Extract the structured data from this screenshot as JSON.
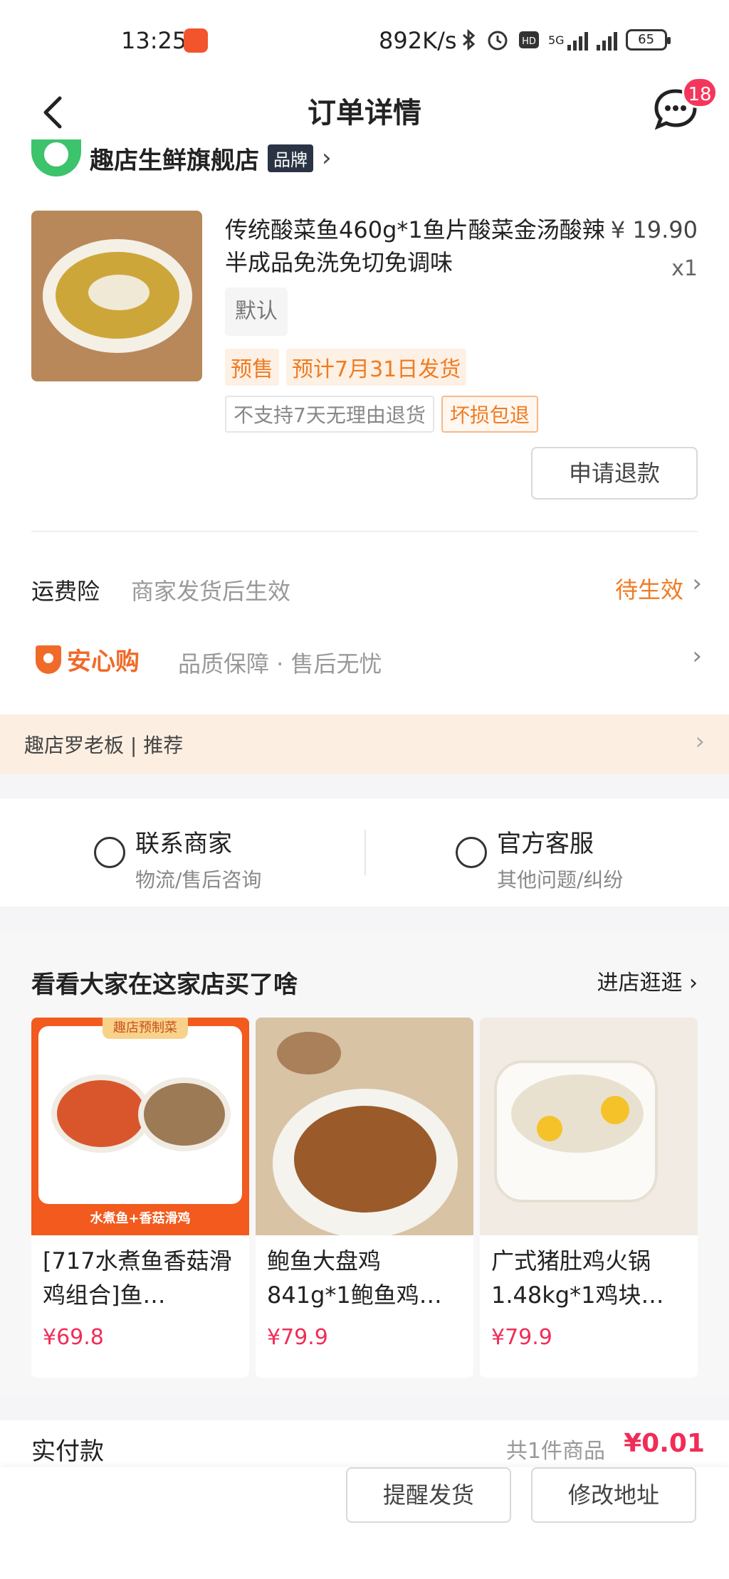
{
  "status_bar": {
    "time": "13:25",
    "net_speed": "892K/s",
    "network": "5G",
    "battery": "65"
  },
  "nav": {
    "title": "订单详情",
    "message_badge": "18"
  },
  "shop": {
    "name": "趣店生鲜旗舰店",
    "brand_tag": "品牌"
  },
  "product": {
    "title": "传统酸菜鱼460g*1鱼片酸菜金汤酸辣半成品免洗免切免调味",
    "price": "¥ 19.90",
    "quantity": "x1",
    "spec": "默认",
    "tag_presale": "预售",
    "tag_ship_date": "预计7月31日发货",
    "tag_no_return": "不支持7天无理由退货",
    "tag_damage": "坏损包退",
    "refund_button": "申请退款"
  },
  "insurance": {
    "label": "运费险",
    "desc": "商家发货后生效",
    "status": "待生效"
  },
  "anxin": {
    "label": "安心购",
    "desc": "品质保障 · 售后无忧"
  },
  "recommend_bar": {
    "text": "趣店罗老板 | 推荐"
  },
  "contact": {
    "merchant_title": "联系商家",
    "merchant_sub": "物流/售后咨询",
    "service_title": "官方客服",
    "service_sub": "其他问题/纠纷"
  },
  "recommendations": {
    "heading": "看看大家在这家店买了啥",
    "more": "进店逛逛",
    "items": [
      {
        "badge": "趣店预制菜",
        "caption": "水煮鱼+香菇滑鸡",
        "name": "[717水煮鱼香菇滑鸡组合]鱼…",
        "price": "¥69.8"
      },
      {
        "name": "鲍鱼大盘鸡841g*1鲍鱼鸡…",
        "price": "¥79.9"
      },
      {
        "name": "广式猪肚鸡火锅1.48kg*1鸡块…",
        "price": "¥79.9"
      }
    ]
  },
  "payment": {
    "label": "实付款",
    "count": "共1件商品",
    "amount": "¥0.01"
  },
  "actions": {
    "remind": "提醒发货",
    "modify_address": "修改地址"
  },
  "colors": {
    "accent_orange": "#f07b22",
    "price_red": "#f02d57",
    "badge_red": "#f5365c"
  }
}
